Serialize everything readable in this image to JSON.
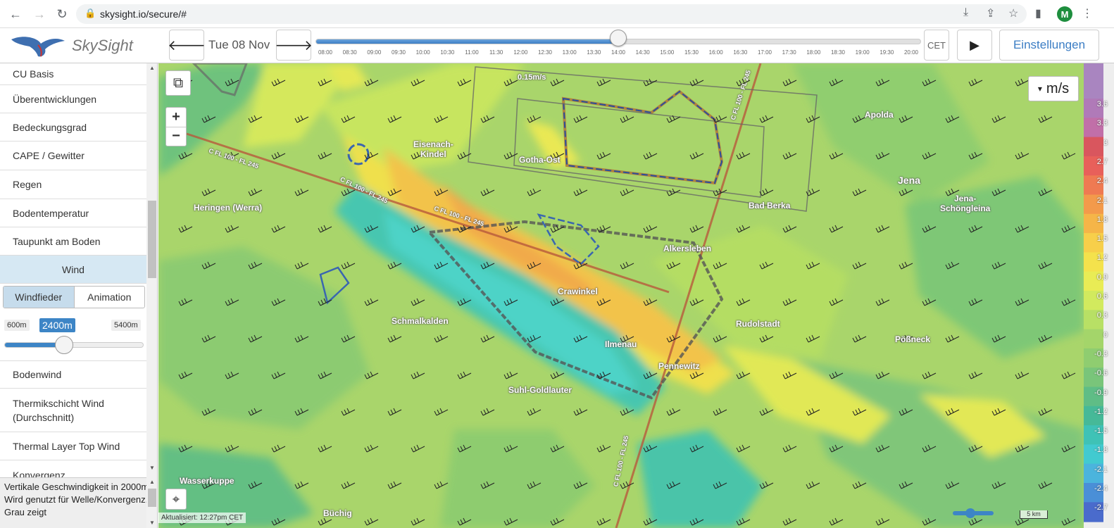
{
  "browser": {
    "url": "skysight.io/secure/#",
    "profile_initial": "M"
  },
  "header": {
    "brand": "SkySight",
    "date": "Tue 08 Nov",
    "timezone": "CET",
    "settings_label": "Einstellungen",
    "timeline": {
      "ticks": [
        "08:00",
        "08:30",
        "09:00",
        "09:30",
        "10:00",
        "10:30",
        "11:00",
        "11:30",
        "12:00",
        "12:30",
        "13:00",
        "13:30",
        "14:00",
        "14:30",
        "15:00",
        "15:30",
        "16:00",
        "16:30",
        "17:00",
        "17:30",
        "18:00",
        "18:30",
        "19:00",
        "19:30",
        "20:00"
      ],
      "selected": "14:00",
      "progress": 0.5
    }
  },
  "sidebar": {
    "items": [
      "CU Basis",
      "Überentwicklungen",
      "Bedeckungsgrad",
      "CAPE / Gewitter",
      "Regen",
      "Bodentemperatur",
      "Taupunkt am Boden"
    ],
    "active_item": "Wind",
    "wind_tabs": [
      "Windfieder",
      "Animation"
    ],
    "altitude": {
      "min": "600m",
      "selected": "2400m",
      "max": "5400m",
      "fraction": 0.375
    },
    "items_after": [
      "Bodenwind",
      "Thermikschicht Wind (Durchschnitt)",
      "Thermal Layer Top Wind",
      "Konvergenz"
    ],
    "description": "Vertikale Geschwindigkeit in 2000m. Wird genutzt für Welle/Konvergenz. Grau zeigt"
  },
  "map": {
    "unit": "m/s",
    "attribution": "Aktualisiert: 12:27pm CET",
    "scale": "5 km",
    "places": [
      {
        "name": "Eisenach-",
        "name2": "Kindel"
      },
      {
        "name": "Gotha-Ost"
      },
      {
        "name": "Apolda"
      },
      {
        "name": "Jena"
      },
      {
        "name": "Jena-",
        "name2": "Schöngleina"
      },
      {
        "name": "Bad Berka"
      },
      {
        "name": "Heringen (Werra)"
      },
      {
        "name": "Alkersleben"
      },
      {
        "name": "Crawinkel"
      },
      {
        "name": "Schmalkalden"
      },
      {
        "name": "Rudolstadt"
      },
      {
        "name": "Pößneck"
      },
      {
        "name": "Ilmenau"
      },
      {
        "name": "Pennewitz"
      },
      {
        "name": "Suhl-Goldlauter"
      },
      {
        "name": "Wasserkuppe"
      },
      {
        "name": "Büchig"
      }
    ],
    "airspace_labels": [
      "C FL 100 - FL 245",
      "C FL 100 - FL 245",
      "C FL 100 - FL 245",
      "C FL 100 - FL 245",
      "C FL 100 - FL 245"
    ],
    "value_label": "0.15m/s"
  },
  "legend": {
    "labels": [
      "3.6",
      "3.3",
      "3",
      "2.7",
      "2.4",
      "2.1",
      "1.8",
      "1.5",
      "1.2",
      "0.9",
      "0.6",
      "0.3",
      "0",
      "-0.3",
      "-0.6",
      "-0.9",
      "-1.2",
      "-1.5",
      "-1.8",
      "-2.1",
      "-2.4",
      "-2.7"
    ],
    "colors": [
      "#b07ab8",
      "#c16fa8",
      "#d9565e",
      "#e8605a",
      "#ef7a52",
      "#f39a4b",
      "#f5b548",
      "#f7cf4a",
      "#f4e24c",
      "#e9ec55",
      "#d2ea5e",
      "#b8e065",
      "#a4d56a",
      "#8fcd70",
      "#79c57a",
      "#5fbd86",
      "#46b998",
      "#3fc2b6",
      "#42cad0",
      "#4bb4dd",
      "#4a8fd7",
      "#4a6bcc"
    ]
  }
}
